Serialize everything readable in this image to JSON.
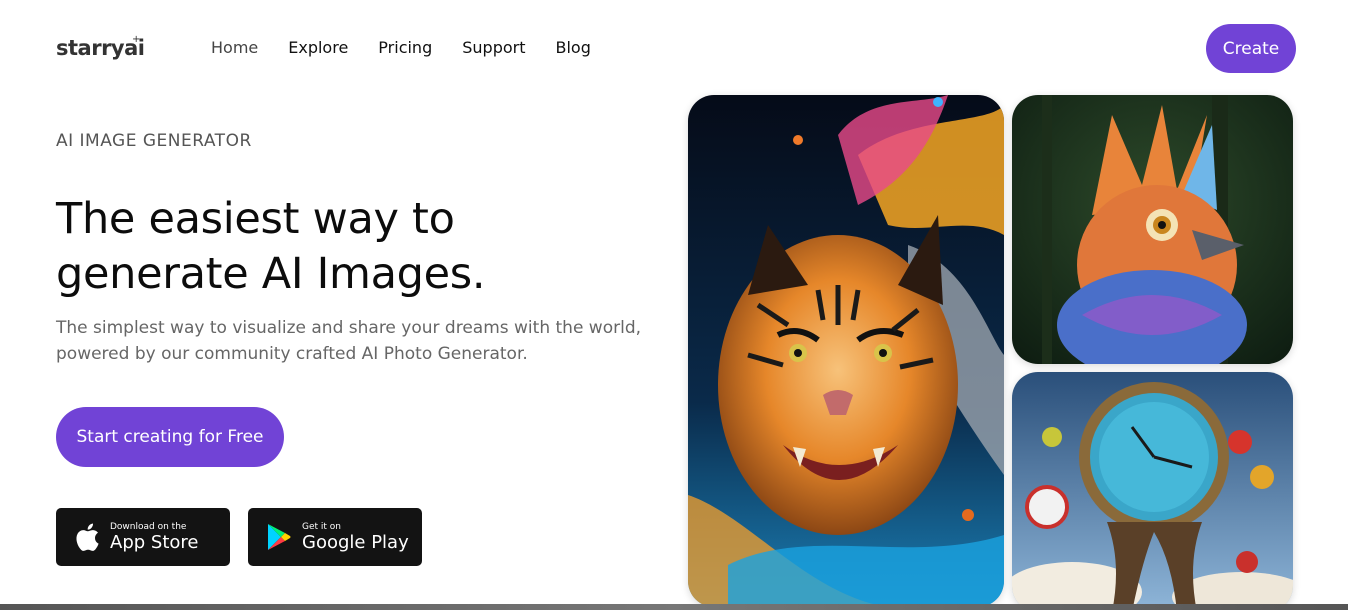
{
  "brand": {
    "name": "starryai",
    "star": "+"
  },
  "nav": {
    "links": [
      {
        "label": "Home"
      },
      {
        "label": "Explore"
      },
      {
        "label": "Pricing"
      },
      {
        "label": "Support"
      },
      {
        "label": "Blog"
      }
    ],
    "create_label": "Create"
  },
  "hero": {
    "eyebrow": "AI IMAGE GENERATOR",
    "headline_line1": "The easiest way to",
    "headline_line2": "generate AI Images.",
    "subtext": "The simplest way to visualize and share your dreams with the world, powered by our community crafted AI Photo Generator.",
    "cta_label": "Start creating for Free"
  },
  "stores": {
    "apple": {
      "small": "Download on the",
      "big": "App Store",
      "icon": "apple-icon"
    },
    "google": {
      "small": "Get it on",
      "big": "Google Play",
      "icon": "google-play-icon"
    }
  },
  "gallery": [
    {
      "name": "tiger-image"
    },
    {
      "name": "bird-image"
    },
    {
      "name": "clock-image"
    }
  ],
  "colors": {
    "accent": "#7143d6",
    "store_bg": "#131313"
  }
}
